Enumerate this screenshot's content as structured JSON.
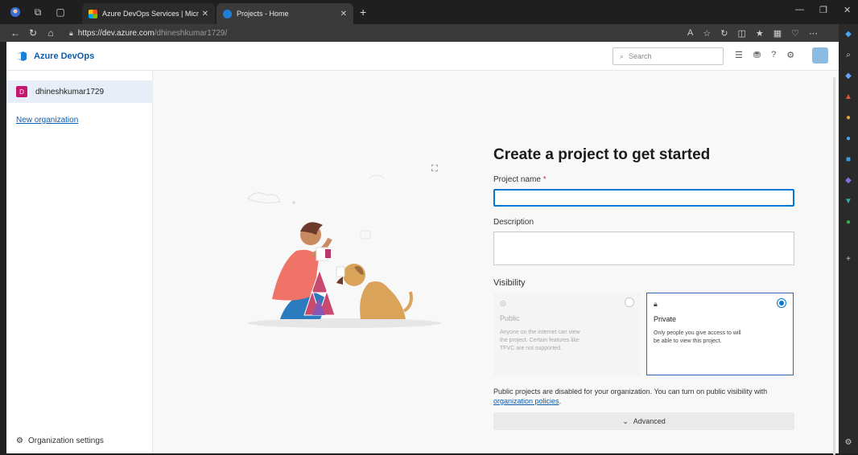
{
  "browser": {
    "tabs": [
      {
        "title": "Azure DevOps Services | Microso",
        "active": false
      },
      {
        "title": "Projects - Home",
        "active": true
      }
    ],
    "url_scheme_host": "https://dev.azure.com",
    "url_path": "/dhineshkumar1729/"
  },
  "app": {
    "product_name": "Azure DevOps",
    "search_placeholder": "Search"
  },
  "sidebar": {
    "org_initial": "D",
    "org_name": "dhineshkumar1729",
    "new_org_label": "New organization",
    "settings_label": "Organization settings"
  },
  "form": {
    "heading": "Create a project to get started",
    "project_name_label": "Project name",
    "required_marker": "*",
    "project_name_value": "",
    "description_label": "Description",
    "description_value": "",
    "visibility_label": "Visibility",
    "public": {
      "title": "Public",
      "desc": "Anyone on the internet can view the project. Certain features like TFVC are not supported."
    },
    "private": {
      "title": "Private",
      "desc": "Only people you give access to will be able to view this project."
    },
    "selected_visibility": "Private",
    "notice_text": "Public projects are disabled for your organization. You can turn on public visibility with",
    "notice_link": "organization policies",
    "notice_end": ".",
    "advanced_label": "Advanced"
  },
  "colors": {
    "accent": "#0078d4",
    "brand": "#0b5cad",
    "org_badge": "#c4166e"
  }
}
